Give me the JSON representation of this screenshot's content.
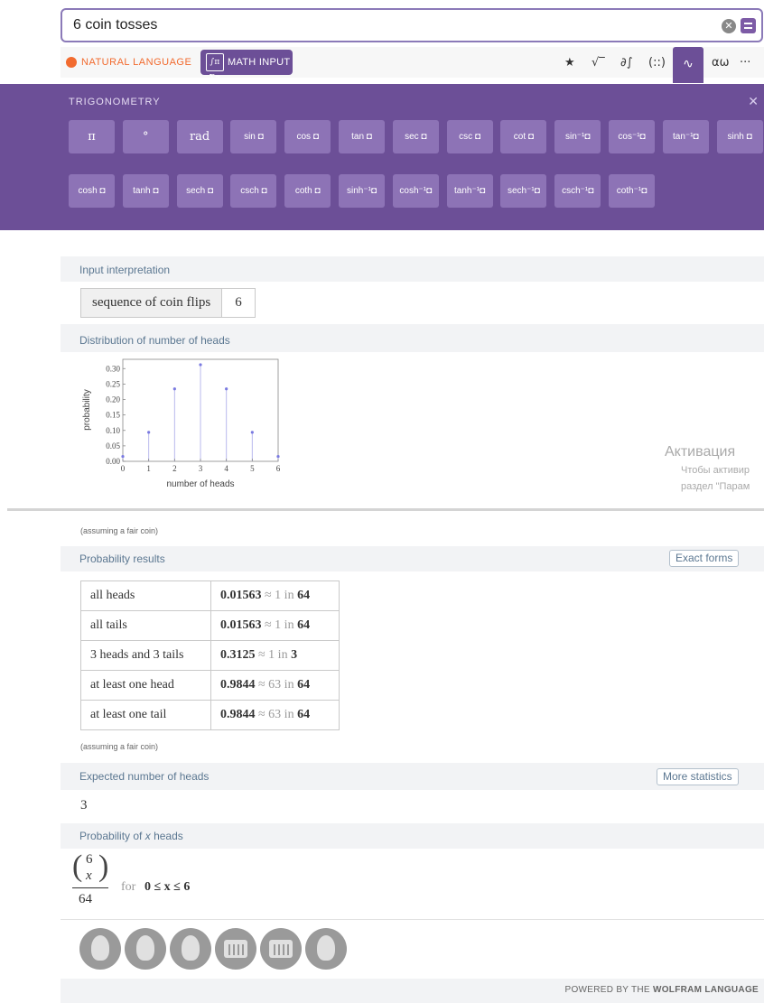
{
  "search": {
    "query": "6 coin tosses"
  },
  "modes": {
    "natural_language": "NATURAL LANGUAGE",
    "math_input": "MATH INPUT",
    "math_icon": "∫π Σα"
  },
  "toolbar": {
    "icons": [
      "★",
      "√‾",
      "∂∫",
      "(::)",
      "∿",
      "αω",
      "···"
    ]
  },
  "keyboard": {
    "title": "TRIGONOMETRY",
    "row1": [
      "π",
      "°",
      "rad",
      "sin ◘",
      "cos ◘",
      "tan ◘",
      "sec ◘",
      "csc ◘",
      "cot ◘",
      "sin⁻¹◘",
      "cos⁻¹◘",
      "tan⁻¹◘",
      "sinh ◘"
    ],
    "row2": [
      "cosh ◘",
      "tanh ◘",
      "sech ◘",
      "csch ◘",
      "coth ◘",
      "sinh⁻¹◘",
      "cosh⁻¹◘",
      "tanh⁻¹◘",
      "sech⁻¹◘",
      "csch⁻¹◘",
      "coth⁻¹◘"
    ]
  },
  "input_interpretation": {
    "header": "Input interpretation",
    "key": "sequence of coin flips",
    "value": "6"
  },
  "distribution": {
    "header": "Distribution of number of heads",
    "chart_data": {
      "type": "scatter",
      "x": [
        0,
        1,
        2,
        3,
        4,
        5,
        6
      ],
      "y": [
        0.0156,
        0.0938,
        0.2344,
        0.3125,
        0.2344,
        0.0938,
        0.0156
      ],
      "xlabel": "number of heads",
      "ylabel": "probability",
      "xlim": [
        0,
        6
      ],
      "ylim": [
        0,
        0.33
      ],
      "yticks": [
        "0.00",
        "0.05",
        "0.10",
        "0.15",
        "0.20",
        "0.25",
        "0.30"
      ],
      "xticks": [
        "0",
        "1",
        "2",
        "3",
        "4",
        "5",
        "6"
      ],
      "style": "stem",
      "color": "#7a7ae0"
    }
  },
  "watermark": {
    "line1": "Активация",
    "line2": "Чтобы активир",
    "line3": "раздел \"Парам"
  },
  "assumption_note_1": "(assuming a fair coin)",
  "probability_results": {
    "header": "Probability results",
    "button": "Exact forms",
    "rows": [
      {
        "label": "all heads",
        "value": "0.01563",
        "approx": "≈ 1 in",
        "odds": "64"
      },
      {
        "label": "all tails",
        "value": "0.01563",
        "approx": "≈ 1 in",
        "odds": "64"
      },
      {
        "label": "3 heads and 3 tails",
        "value": "0.3125",
        "approx": "≈ 1 in",
        "odds": "3"
      },
      {
        "label": "at least one head",
        "value": "0.9844",
        "approx": "≈ 63 in",
        "odds": "64"
      },
      {
        "label": "at least one tail",
        "value": "0.9844",
        "approx": "≈ 63 in",
        "odds": "64"
      }
    ]
  },
  "assumption_note_2": "(assuming a fair coin)",
  "expected": {
    "header": "Expected number of heads",
    "button": "More statistics",
    "value": "3"
  },
  "probability_x": {
    "header_prefix": "Probability of",
    "header_var": "x",
    "header_suffix": "heads",
    "binom_top": "6",
    "binom_bottom": "x",
    "denominator": "64",
    "for_word": "for",
    "range": "0 ≤ x ≤ 6"
  },
  "coins": [
    "head",
    "head",
    "head",
    "tail",
    "tail",
    "head"
  ],
  "footer": {
    "powered_prefix": "POWERED BY THE",
    "powered_brand": "WOLFRAM LANGUAGE"
  },
  "colors": {
    "accent": "#6c4f97",
    "key": "#8d73b6",
    "header_text": "#5b7791",
    "orange": "#f26b2f"
  }
}
